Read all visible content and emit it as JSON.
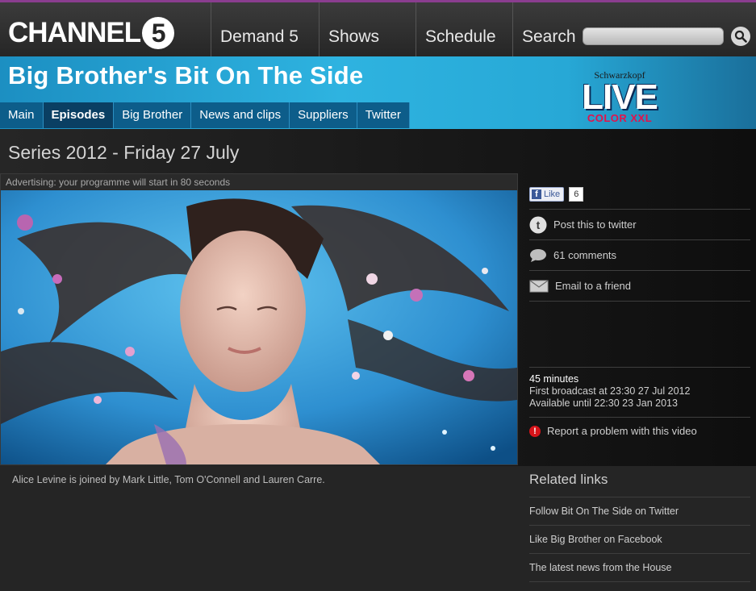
{
  "brand": {
    "logo_text": "CHANNEL",
    "logo_number": "5"
  },
  "topnav": {
    "items": [
      {
        "label": "Demand 5"
      },
      {
        "label": "Shows"
      },
      {
        "label": "Schedule"
      },
      {
        "label": "Search"
      }
    ]
  },
  "show": {
    "title": "Big Brother's Bit On The Side",
    "subnav": [
      {
        "label": "Main"
      },
      {
        "label": "Episodes",
        "active": true
      },
      {
        "label": "Big Brother"
      },
      {
        "label": "News and clips"
      },
      {
        "label": "Suppliers"
      },
      {
        "label": "Twitter"
      }
    ]
  },
  "sponsor": {
    "brand": "Schwarzkopf",
    "headline": "LIVE",
    "tagline": "COLOR XXL"
  },
  "episode": {
    "title": "Series 2012 - Friday 27 July",
    "ad_notice": "Advertising: your programme will start in 80 seconds",
    "description": "Alice Levine is joined by Mark Little, Tom O'Connell and Lauren Carre."
  },
  "social": {
    "like_label": "Like",
    "like_count": "6",
    "twitter_label": "Post this to twitter",
    "comments_label": "61 comments",
    "email_label": "Email to a friend"
  },
  "info": {
    "duration": "45 minutes",
    "first_broadcast": "First broadcast at 23:30 27 Jul 2012",
    "available_until": "Available until 22:30 23 Jan 2013",
    "report_label": "Report a problem with this video"
  },
  "related": {
    "title": "Related links",
    "links": [
      {
        "label": "Follow Bit On The Side on Twitter"
      },
      {
        "label": "Like Big Brother on Facebook"
      },
      {
        "label": "The latest news from the House"
      }
    ]
  },
  "colors": {
    "accent_blue": "#2eb3e0",
    "subnav_blue": "#0d5d8a",
    "background": "#252525",
    "report_red": "#d7141a"
  }
}
